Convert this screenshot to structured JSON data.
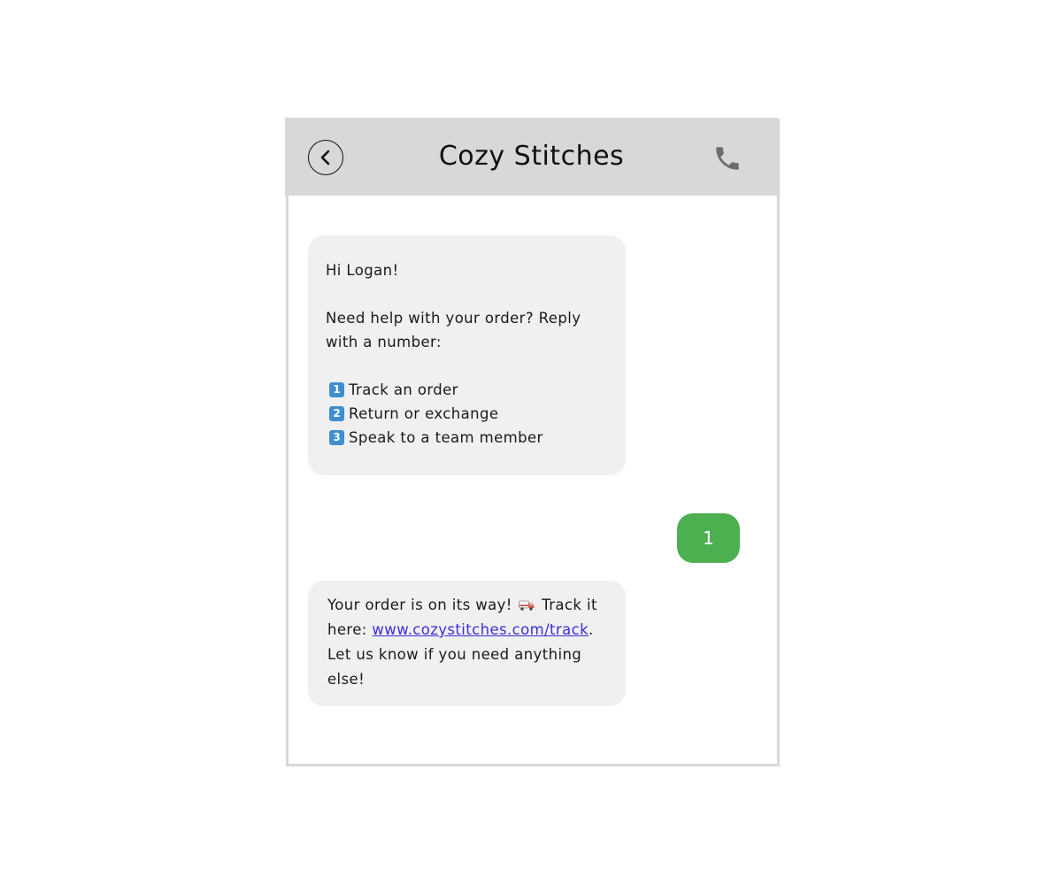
{
  "header": {
    "title": "Cozy Stitches",
    "back_icon": "chevron-left-icon",
    "call_icon": "phone-icon"
  },
  "messages": [
    {
      "direction": "incoming",
      "greeting": "Hi Logan!",
      "prompt_line1": "Need help with your order? Reply",
      "prompt_line2": "with a number:",
      "options": [
        {
          "number": "1",
          "label": "Track an order"
        },
        {
          "number": "2",
          "label": "Return or exchange"
        },
        {
          "number": "3",
          "label": "Speak to a team member"
        }
      ]
    },
    {
      "direction": "outgoing",
      "text": "1"
    },
    {
      "direction": "incoming",
      "line1_a": "Your order is on its way!",
      "line1_b": "Track it",
      "line2_a": "here:",
      "link_text": "www.cozystitches.com/track",
      "line2_b": ".",
      "line3": "Let us know if you need anything",
      "line4": "else!"
    }
  ],
  "colors": {
    "header_bg": "#d8d8d8",
    "incoming_bg": "#f0f0f0",
    "outgoing_bg": "#4caf50",
    "link": "#3b2fd6",
    "number_badge": "#3d8fd1"
  }
}
